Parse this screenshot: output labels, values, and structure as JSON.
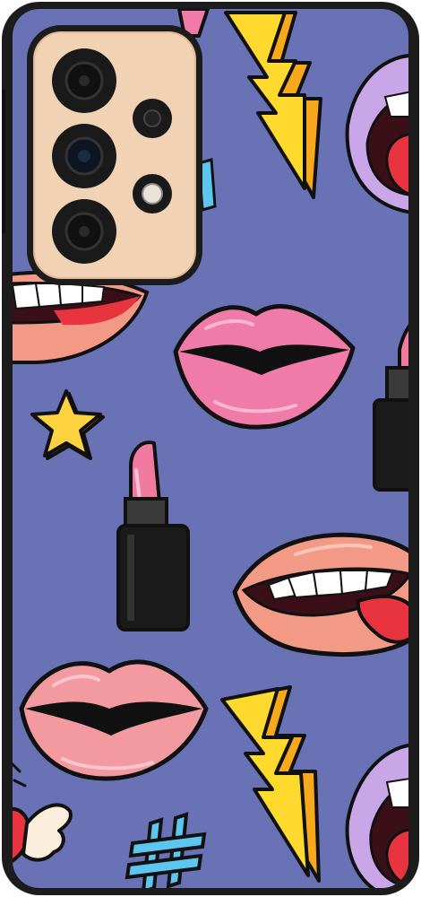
{
  "product": {
    "kind": "phone-case",
    "case_color": "#1c1c1c",
    "background_color": "#6872b5",
    "camera_module_color": "#f2d2b4",
    "lens_color": "#111111"
  },
  "pattern": {
    "motifs": [
      "lips-kiss-icon",
      "lips-smile-tongue-icon",
      "lightning-bolt-icon",
      "lipstick-icon",
      "star-icon",
      "hashtag-icon",
      "wing-heart-icon"
    ],
    "colors": {
      "lip_pink": "#f07aa8",
      "lip_salmon": "#f29a86",
      "tongue_red": "#e8343f",
      "bolt_yellow": "#ffd92e",
      "bolt_orange": "#f7a81b",
      "star_yellow": "#ffd23f",
      "hashtag_blue": "#5cc6ee",
      "lipstick_pink": "#f07aa0",
      "outline": "#111111"
    }
  }
}
